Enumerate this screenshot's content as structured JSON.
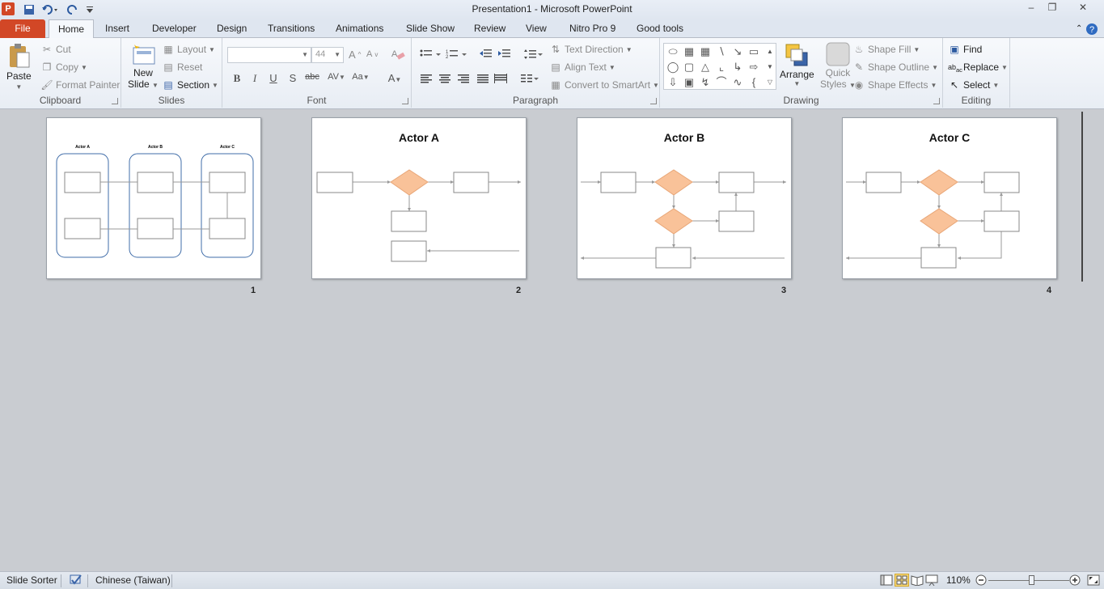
{
  "window": {
    "title": "Presentation1  -  Microsoft PowerPoint",
    "app_icon": "P"
  },
  "tabs": [
    "File",
    "Home",
    "Insert",
    "Developer",
    "Design",
    "Transitions",
    "Animations",
    "Slide Show",
    "Review",
    "View",
    "Nitro Pro 9",
    "Good tools"
  ],
  "ribbon": {
    "clipboard": {
      "label": "Clipboard",
      "paste": "Paste",
      "cut": "Cut",
      "copy": "Copy",
      "format_painter": "Format Painter"
    },
    "slides": {
      "label": "Slides",
      "new_slide_1": "New",
      "new_slide_2": "Slide",
      "layout": "Layout",
      "reset": "Reset",
      "section": "Section"
    },
    "font": {
      "label": "Font",
      "font_size": "44"
    },
    "paragraph": {
      "label": "Paragraph",
      "text_direction": "Text Direction",
      "align_text": "Align Text",
      "convert_smartart": "Convert to SmartArt"
    },
    "drawing": {
      "label": "Drawing",
      "arrange": "Arrange",
      "quick_styles_1": "Quick",
      "quick_styles_2": "Styles",
      "shape_fill": "Shape Fill",
      "shape_outline": "Shape Outline",
      "shape_effects": "Shape Effects"
    },
    "editing": {
      "label": "Editing",
      "find": "Find",
      "replace": "Replace",
      "select": "Select"
    }
  },
  "slides": [
    {
      "num": "1",
      "title": "",
      "lanes": [
        "Actor A",
        "Actor B",
        "Actor C"
      ]
    },
    {
      "num": "2",
      "title": "Actor A"
    },
    {
      "num": "3",
      "title": "Actor B"
    },
    {
      "num": "4",
      "title": "Actor C"
    }
  ],
  "statusbar": {
    "view": "Slide Sorter",
    "language": "Chinese (Taiwan)",
    "zoom": "110%"
  },
  "colors": {
    "accent": "#d24726",
    "diamond": "#f9c299",
    "lane": "#3f6ca8"
  }
}
